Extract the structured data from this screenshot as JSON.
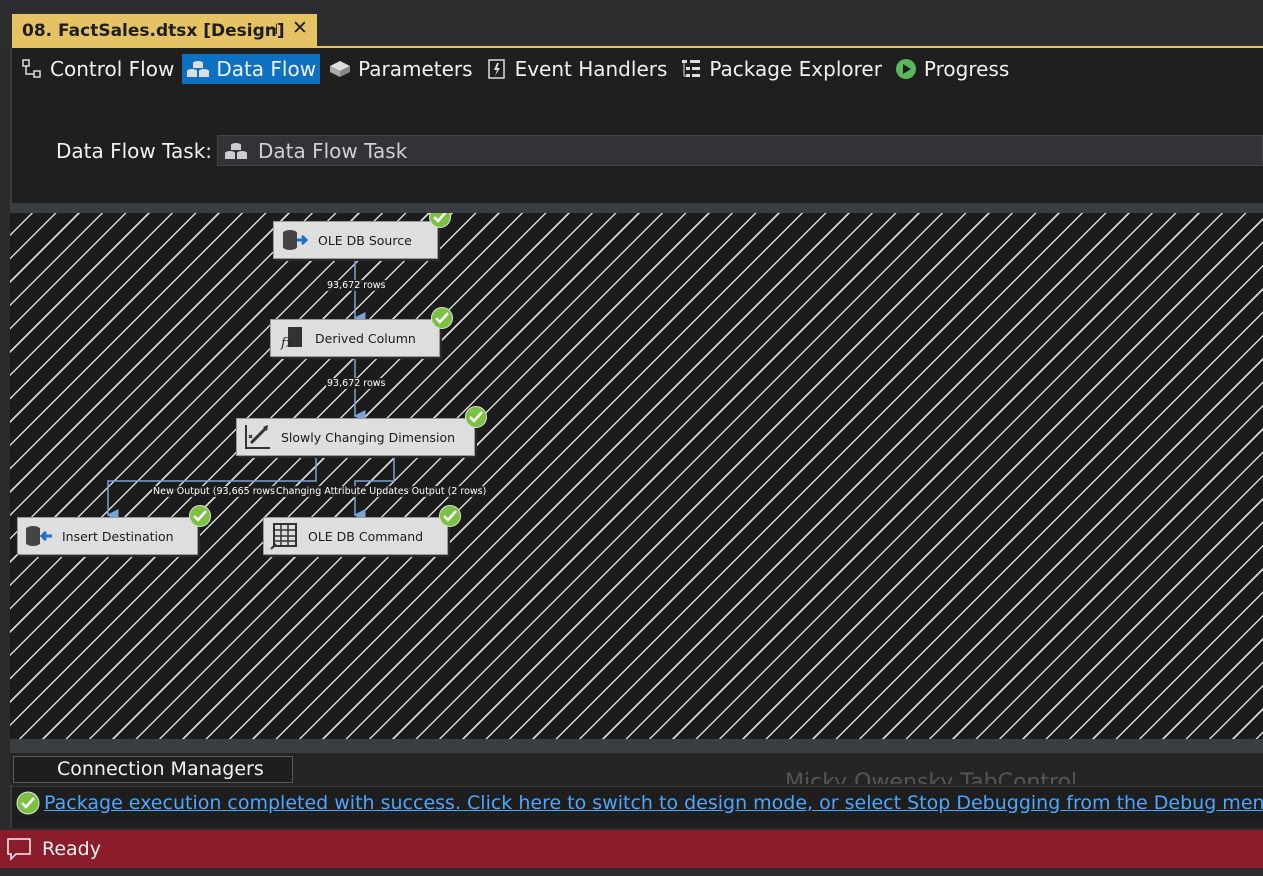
{
  "document_tab": {
    "title": "08. FactSales.dtsx [Design]",
    "pin_icon": "pin-icon",
    "close_icon": "close-icon",
    "accent_color": "#e5c365"
  },
  "designer_tabs": [
    {
      "label": "Control Flow",
      "icon": "control-flow-icon",
      "active": false
    },
    {
      "label": "Data Flow",
      "icon": "data-flow-icon",
      "active": true
    },
    {
      "label": "Parameters",
      "icon": "parameters-icon",
      "active": false
    },
    {
      "label": "Event Handlers",
      "icon": "event-handlers-icon",
      "active": false
    },
    {
      "label": "Package Explorer",
      "icon": "package-explorer-icon",
      "active": false
    },
    {
      "label": "Progress",
      "icon": "progress-icon",
      "active": false
    }
  ],
  "task_selector": {
    "label": "Data Flow Task:",
    "value": "Data Flow Task"
  },
  "components": {
    "ole_db_source": {
      "label": "OLE DB Source",
      "status": "success"
    },
    "derived_column": {
      "label": "Derived Column",
      "status": "success"
    },
    "scd": {
      "label": "Slowly Changing Dimension",
      "status": "success"
    },
    "insert_destination": {
      "label": "Insert Destination",
      "status": "success"
    },
    "ole_db_command": {
      "label": "OLE DB Command",
      "status": "success"
    }
  },
  "paths": {
    "source_to_derived": "93,672 rows",
    "derived_to_scd": "93,672 rows",
    "scd_new_output": "New Output (93,665 rows)",
    "scd_changing_output": "Changing Attribute Updates Output (2 rows)"
  },
  "connection_managers": {
    "tab_label": "Connection Managers",
    "watermark": "Micky Owensky TabControl"
  },
  "info_bar": {
    "message": "Package execution completed with success. Click here to switch to design mode, or select Stop Debugging from the Debug menu."
  },
  "status_bar": {
    "text": "Ready",
    "color": "#8b1c2b"
  }
}
